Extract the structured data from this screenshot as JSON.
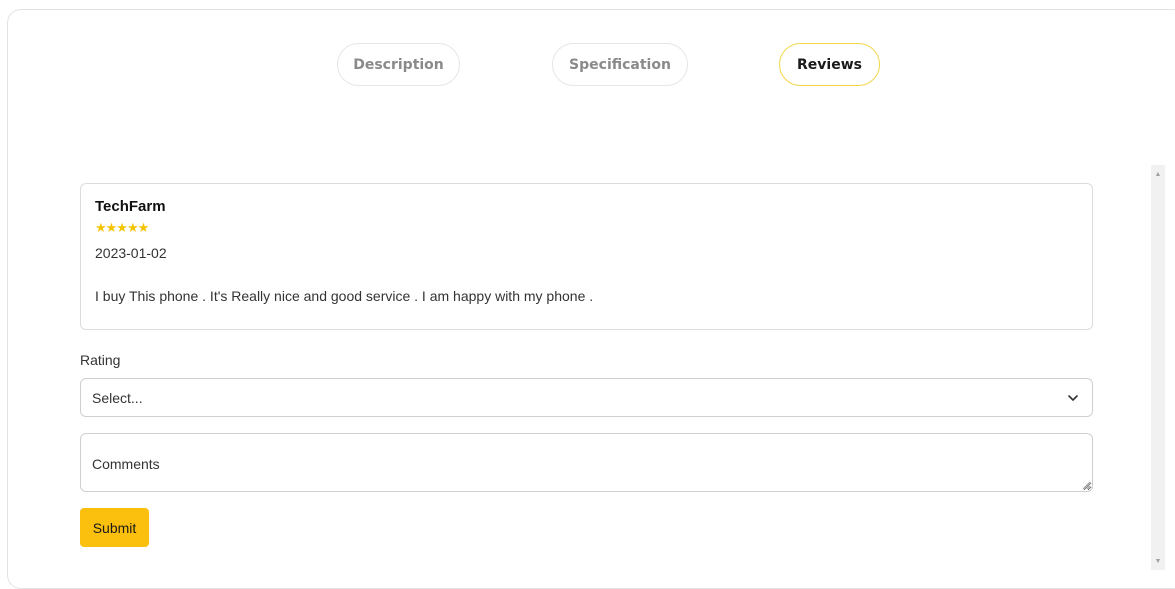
{
  "tabs": [
    {
      "label": "Description",
      "active": false
    },
    {
      "label": "Specification",
      "active": false
    },
    {
      "label": "Reviews",
      "active": true
    }
  ],
  "review": {
    "author": "TechFarm",
    "stars": "★★★★★",
    "rating": 5,
    "date": "2023-01-02",
    "text": "I buy This phone . It's Really nice and good service . I am happy with my phone ."
  },
  "form": {
    "rating_label": "Rating",
    "rating_select_value": "Select...",
    "comments_placeholder": "Comments",
    "submit_label": "Submit"
  },
  "colors": {
    "accent": "#fbbf0d",
    "star": "#f5c400",
    "active_tab_border": "#f2d648"
  },
  "icons": {
    "select_chevron": "chevron-down-icon",
    "scroll_up": "scroll-up-arrow-icon",
    "scroll_down": "scroll-down-arrow-icon",
    "textarea_resize": "resize-grip-icon"
  }
}
